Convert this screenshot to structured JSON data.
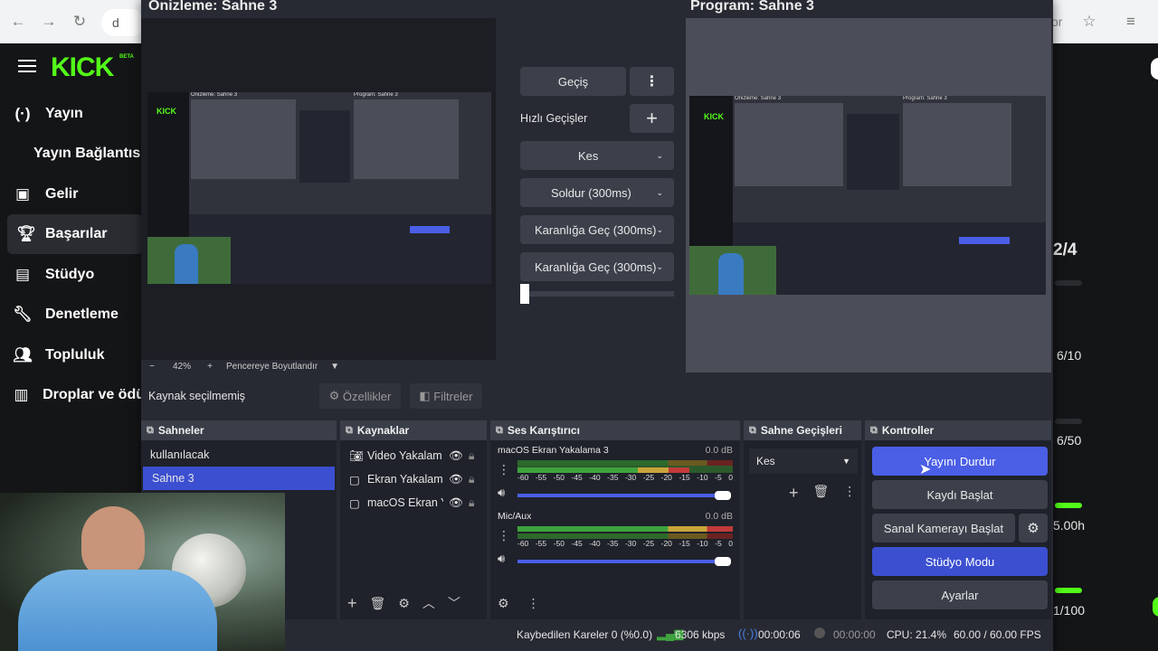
{
  "browser": {
    "address_text": "d",
    "right_text": "or"
  },
  "kick": {
    "logo": "KICK",
    "logo_badge": "BETA",
    "nav": [
      {
        "label": "Yayın",
        "icon": "broadcast-icon"
      },
      {
        "label": "Yayın Bağlantısı",
        "icon": ""
      },
      {
        "label": "Gelir",
        "icon": "wallet-icon"
      },
      {
        "label": "Başarılar",
        "icon": "trophy-icon"
      },
      {
        "label": "Stüdyo",
        "icon": "studio-icon"
      },
      {
        "label": "Denetleme",
        "icon": "wrench-icon"
      },
      {
        "label": "Topluluk",
        "icon": "community-icon"
      },
      {
        "label": "Droplar ve ödü",
        "icon": "drops-icon"
      }
    ],
    "right_stats": {
      "progress_1": "2/4",
      "stat_a": "6/10",
      "stat_b": "6/50",
      "stat_c": "5.00h",
      "stat_d": "1/100"
    }
  },
  "obs": {
    "preview_title": "Önizleme: Sahne 3",
    "program_title": "Program: Sahne 3",
    "zoom_minus": "−",
    "zoom_value": "42%",
    "zoom_plus": "+",
    "fit_label": "Pencereye Boyutlandır",
    "transition_button": "Geçiş",
    "quick_transitions_label": "Hızlı Geçişler",
    "quick_transitions": [
      "Kes",
      "Soldur (300ms)",
      "Karanlığa Geç (300ms)",
      "Karanlığa Geç (300ms)"
    ],
    "source_status": "Kaynak seçilmemiş",
    "properties_button": "Özellikler",
    "filters_button": "Filtreler",
    "docks": {
      "scenes": {
        "title": "Sahneler",
        "items": [
          "kullanılacak",
          "Sahne 3"
        ],
        "selected": "Sahne 3"
      },
      "sources": {
        "title": "Kaynaklar",
        "items": [
          {
            "label": "Video Yakalam",
            "icon": "camera-icon"
          },
          {
            "label": "Ekran Yakalam",
            "icon": "monitor-icon"
          },
          {
            "label": "macOS Ekran Y",
            "icon": "monitor-icon"
          }
        ]
      },
      "mixer": {
        "title": "Ses Karıştırıcı",
        "channels": [
          {
            "name": "macOS Ekran Yakalama 3",
            "db": "0.0 dB",
            "level": 0.8
          },
          {
            "name": "Mic/Aux",
            "db": "0.0 dB",
            "level": 0.0
          }
        ],
        "ticks": [
          "-60",
          "-55",
          "-50",
          "-45",
          "-40",
          "-35",
          "-30",
          "-25",
          "-20",
          "-15",
          "-10",
          "-5",
          "0"
        ]
      },
      "transitions": {
        "title": "Sahne Geçişleri",
        "selected": "Kes"
      },
      "controls": {
        "title": "Kontroller",
        "stop_stream": "Yayını Durdur",
        "start_record": "Kaydı Başlat",
        "start_virtualcam": "Sanal Kamerayı Başlat",
        "studio_mode": "Stüdyo Modu",
        "settings": "Ayarlar"
      }
    },
    "statusbar": {
      "dropped_frames": "Kaybedilen Kareler 0 (%0.0)",
      "bitrate": "6306 kbps",
      "stream_time": "00:00:06",
      "record_time": "00:00:00",
      "cpu": "CPU: 21.4%",
      "fps": "60.00 / 60.00 FPS"
    },
    "mini_preview": {
      "preview_title": "Önizleme: Sahne 3",
      "program_title": "Program: Sahne 3",
      "logo": "KICK"
    }
  },
  "colors": {
    "kick_green": "#53fc18",
    "obs_accent": "#4a5ee6",
    "obs_bg": "#272a33"
  }
}
